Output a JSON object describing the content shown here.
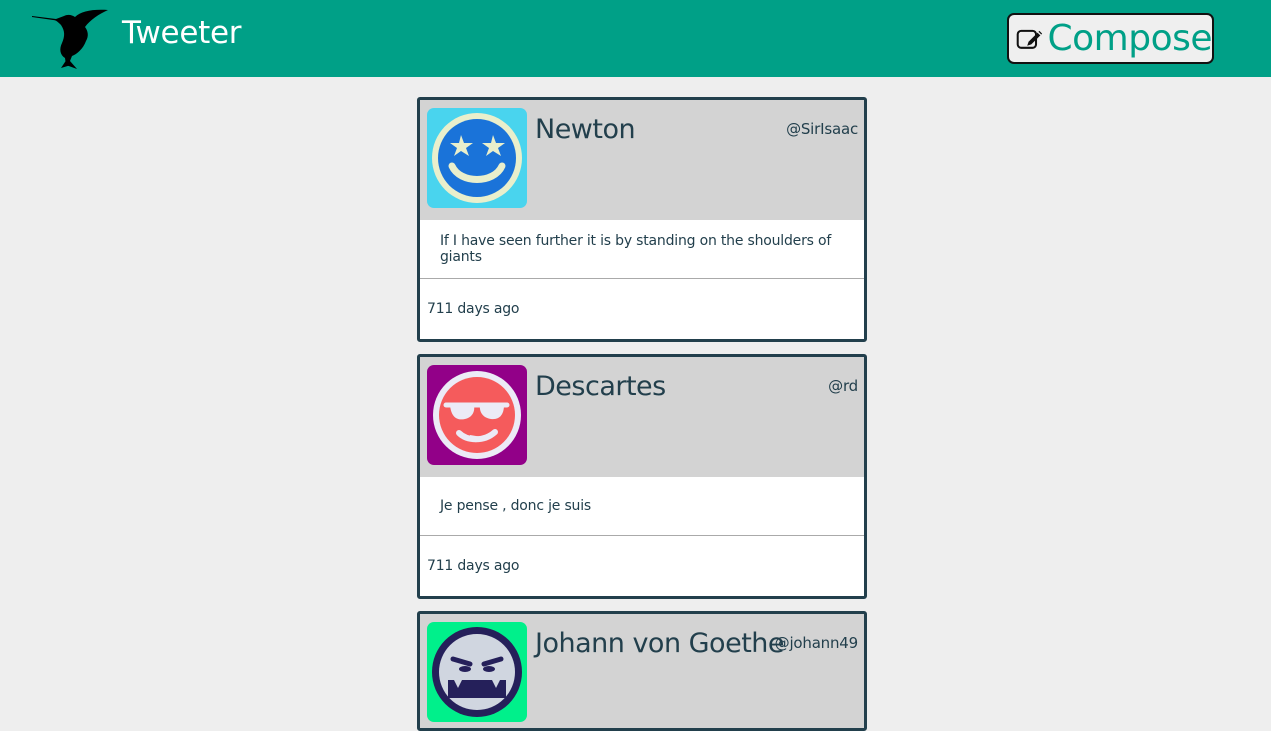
{
  "header": {
    "title": "Tweeter",
    "logo_icon": "hummingbird-icon",
    "compose": {
      "label": "Compose",
      "icon": "edit-square-icon"
    }
  },
  "colors": {
    "header_bg": "#00a087",
    "accent": "#00a087",
    "tweet_border": "#223f4c",
    "page_bg": "#eeeeee"
  },
  "tweets": [
    {
      "name": "Newton",
      "handle": "@SirIsaac",
      "content": "If I have seen further it is by standing on the shoulders of giants",
      "time": "711 days ago",
      "avatar_icon": "smiley-stars-avatar-icon"
    },
    {
      "name": "Descartes",
      "handle": "@rd",
      "content": "Je pense , donc je suis",
      "time": "711 days ago",
      "avatar_icon": "smiley-sunglasses-avatar-icon"
    },
    {
      "name": "Johann von Goethe",
      "handle": "@johann49",
      "avatar_icon": "smiley-grimace-avatar-icon"
    }
  ]
}
